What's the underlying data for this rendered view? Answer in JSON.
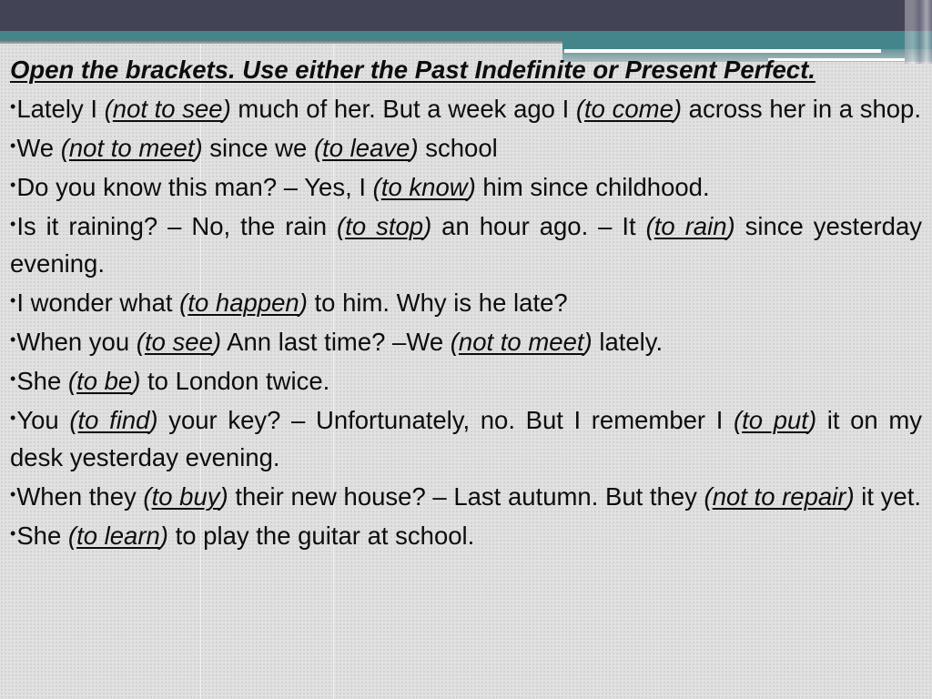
{
  "slide": {
    "title": "Open the brackets. Use either the Past Indefinite or Present Perfect.",
    "bullet_glyph": "•",
    "items": [
      {
        "parts": [
          {
            "t": "text",
            "v": "Lately I "
          },
          {
            "t": "verb",
            "v": "not to see"
          },
          {
            "t": "text",
            "v": " much of her. But a week ago I "
          },
          {
            "t": "verb",
            "v": "to come"
          },
          {
            "t": "text",
            "v": " across her in a shop."
          }
        ]
      },
      {
        "parts": [
          {
            "t": "text",
            "v": "We "
          },
          {
            "t": "verb",
            "v": "not to meet"
          },
          {
            "t": "text",
            "v": " since we "
          },
          {
            "t": "verb",
            "v": "to leave"
          },
          {
            "t": "text",
            "v": " school"
          }
        ]
      },
      {
        "parts": [
          {
            "t": "text",
            "v": "Do you know this man? – Yes, I "
          },
          {
            "t": "verb",
            "v": "to know"
          },
          {
            "t": "text",
            "v": " him since childhood."
          }
        ]
      },
      {
        "parts": [
          {
            "t": "text",
            "v": "Is it raining? – No, the rain "
          },
          {
            "t": "verb",
            "v": "to stop"
          },
          {
            "t": "text",
            "v": " an hour ago. – It "
          },
          {
            "t": "verb",
            "v": "to rain"
          },
          {
            "t": "text",
            "v": " since yesterday evening."
          }
        ]
      },
      {
        "parts": [
          {
            "t": "text",
            "v": "I wonder what "
          },
          {
            "t": "verb",
            "v": "to happen"
          },
          {
            "t": "text",
            "v": " to him. Why is he late?"
          }
        ]
      },
      {
        "parts": [
          {
            "t": "text",
            "v": "When you "
          },
          {
            "t": "verb",
            "v": "to see"
          },
          {
            "t": "text",
            "v": " Ann last time? –We "
          },
          {
            "t": "verb",
            "v": "not to meet"
          },
          {
            "t": "text",
            "v": " lately."
          }
        ]
      },
      {
        "parts": [
          {
            "t": "text",
            "v": "She "
          },
          {
            "t": "verb",
            "v": "to be"
          },
          {
            "t": "text",
            "v": " to London twice."
          }
        ]
      },
      {
        "parts": [
          {
            "t": "text",
            "v": "You "
          },
          {
            "t": "verb",
            "v": "to find"
          },
          {
            "t": "text",
            "v": " your key? – Unfortunately, no. But I remember I "
          },
          {
            "t": "verb",
            "v": "to put"
          },
          {
            "t": "text",
            "v": " it on my desk yesterday evening."
          }
        ]
      },
      {
        "parts": [
          {
            "t": "text",
            "v": "When they "
          },
          {
            "t": "verb",
            "v": "to buy"
          },
          {
            "t": "text",
            "v": " their new house? – Last autumn. But they "
          },
          {
            "t": "verb",
            "v": "not to repair"
          },
          {
            "t": "text",
            "v": " it yet."
          }
        ]
      },
      {
        "parts": [
          {
            "t": "text",
            "v": "She "
          },
          {
            "t": "verb",
            "v": "to learn"
          },
          {
            "t": "text",
            "v": " to play the guitar at school."
          }
        ]
      }
    ]
  },
  "colors": {
    "header_dark": "#434356",
    "header_teal": "#43858a",
    "background": "#e1e1e1",
    "text": "#0d0d0d"
  }
}
